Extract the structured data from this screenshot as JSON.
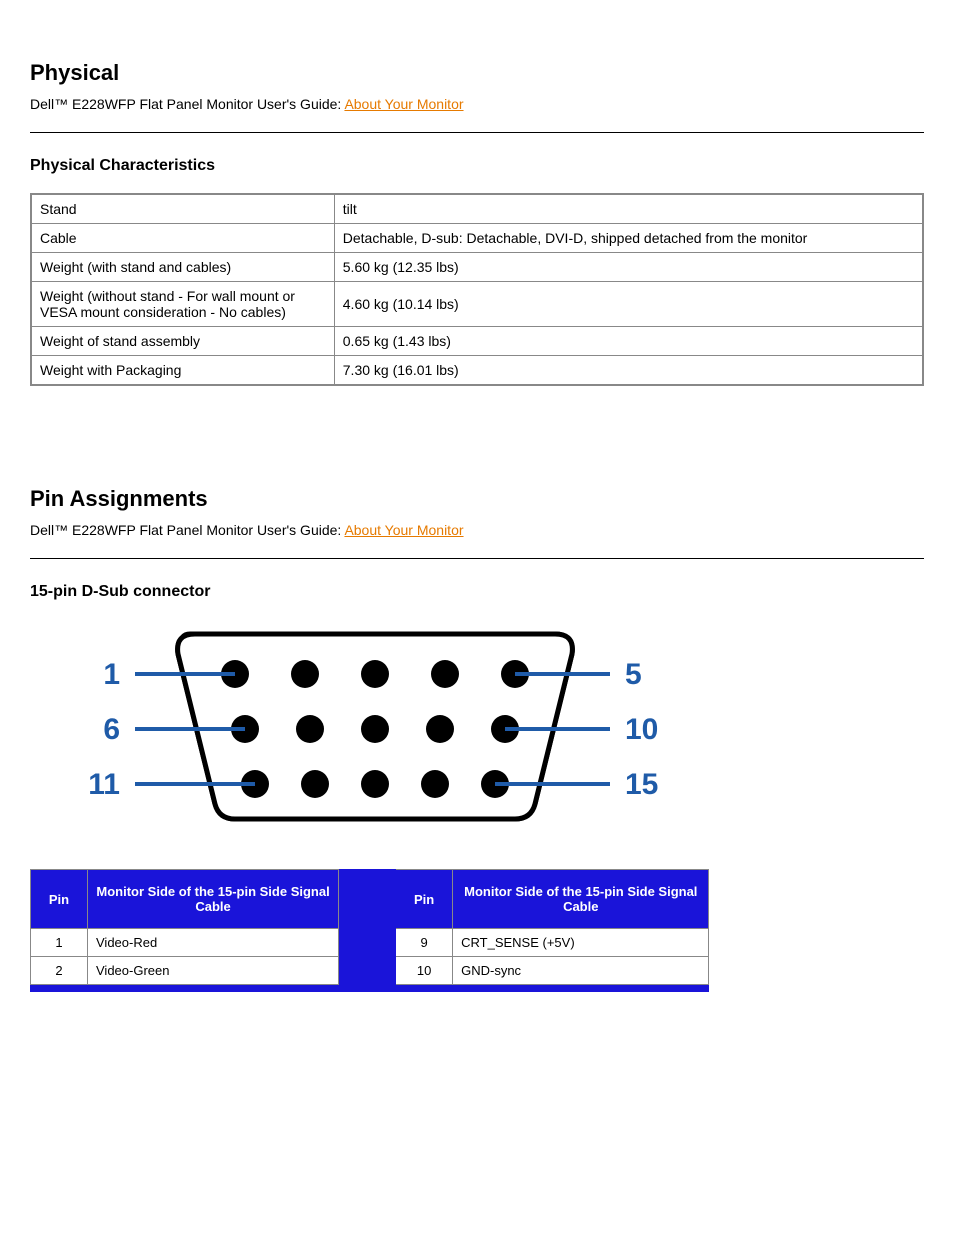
{
  "section1": {
    "title": "Physical",
    "breadcrumb_prefix": "Dell™ E228WFP Flat Panel Monitor User's Guide: ",
    "breadcrumb_link": "About Your Monitor",
    "heading": "Physical Characteristics",
    "rows": [
      {
        "label": "Stand",
        "value": "tilt"
      },
      {
        "label": "Cable",
        "value": "Detachable, D-sub: Detachable, DVI-D, shipped detached from the monitor"
      },
      {
        "label": "Weight (with stand and cables)",
        "value": "5.60 kg (12.35 lbs)"
      },
      {
        "label": "Weight (without stand - For wall mount or VESA mount consideration - No cables)",
        "value": "4.60 kg (10.14 lbs)"
      },
      {
        "label": "Weight of stand assembly",
        "value": "0.65 kg (1.43 lbs)"
      },
      {
        "label": "Weight with Packaging",
        "value": "7.30 kg (16.01 lbs)"
      }
    ]
  },
  "section2": {
    "title": "Pin Assignments",
    "breadcrumb_prefix": "Dell™ E228WFP Flat Panel Monitor User's Guide: ",
    "breadcrumb_link": "About Your Monitor",
    "heading": "15-pin D-Sub connector",
    "connector_labels": {
      "r1_left": "1",
      "r1_right": "5",
      "r2_left": "6",
      "r2_right": "10",
      "r3_left": "11",
      "r3_right": "15"
    },
    "table_headers": {
      "pin": "Pin",
      "side": "Monitor Side of the 15-pin Side Signal Cable"
    },
    "rows_left": [
      {
        "pin": "1",
        "signal": "Video-Red"
      },
      {
        "pin": "2",
        "signal": "Video-Green"
      }
    ],
    "rows_right": [
      {
        "pin": "9",
        "signal": "CRT_SENSE (+5V)"
      },
      {
        "pin": "10",
        "signal": "GND-sync"
      }
    ]
  }
}
